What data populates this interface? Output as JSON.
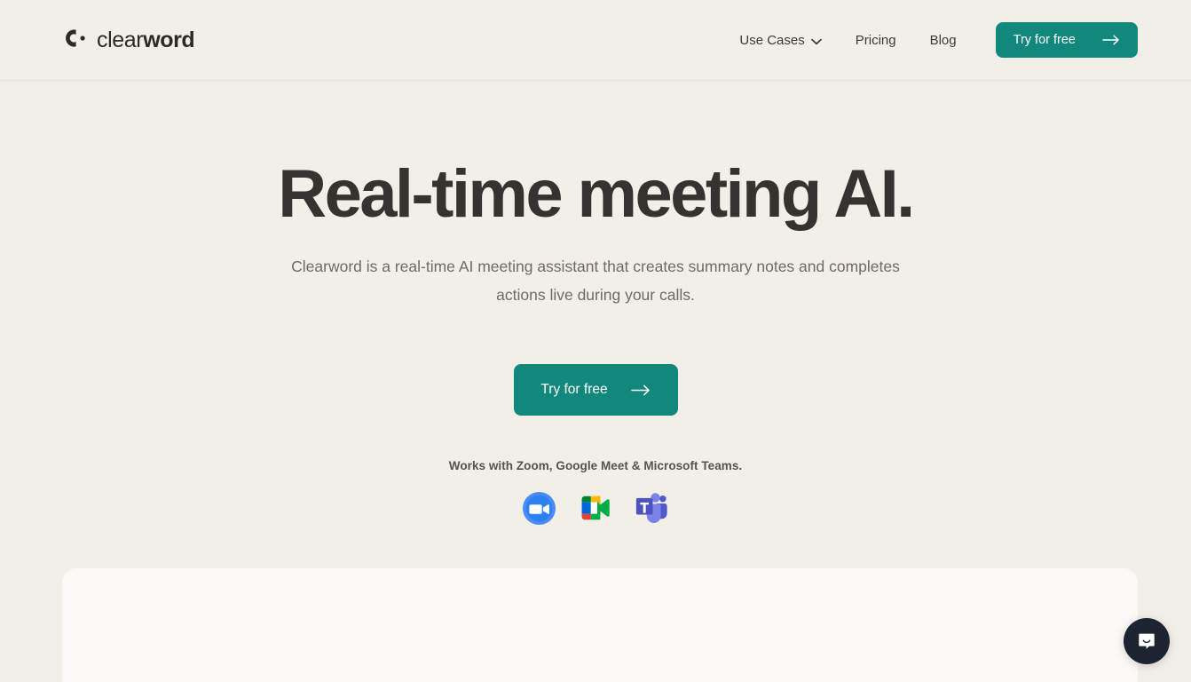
{
  "brand": {
    "name_light": "clear",
    "name_bold": "word",
    "mark_icon": "clearword-c-dot-logo"
  },
  "header": {
    "nav": [
      {
        "label": "Use Cases",
        "has_chevron": true,
        "icon": "chevron-down-icon"
      },
      {
        "label": "Pricing",
        "has_chevron": false
      },
      {
        "label": "Blog",
        "has_chevron": false
      }
    ],
    "cta": {
      "label": "Try for free",
      "icon": "arrow-right-icon"
    }
  },
  "hero": {
    "headline": "Real-time meeting AI.",
    "subheadline": "Clearword is a real-time AI meeting assistant that creates summary notes and completes actions live during your calls.",
    "cta": {
      "label": "Try for free",
      "icon": "arrow-right-icon"
    },
    "works_with": "Works with Zoom, Google Meet & Microsoft Teams.",
    "integrations": [
      {
        "name": "Zoom",
        "icon": "zoom-logo-icon"
      },
      {
        "name": "Google Meet",
        "icon": "google-meet-logo-icon"
      },
      {
        "name": "Microsoft Teams",
        "icon": "microsoft-teams-logo-icon"
      }
    ]
  },
  "widgets": {
    "intercom": {
      "icon": "intercom-chat-icon",
      "label": "Open chat"
    }
  },
  "colors": {
    "page_background": "#F2EFE9",
    "panel_background": "#FBF8F5",
    "accent_teal": "#12887C",
    "headline": "#343330",
    "body_text": "#6F6B64",
    "intercom": "#1C2431"
  }
}
